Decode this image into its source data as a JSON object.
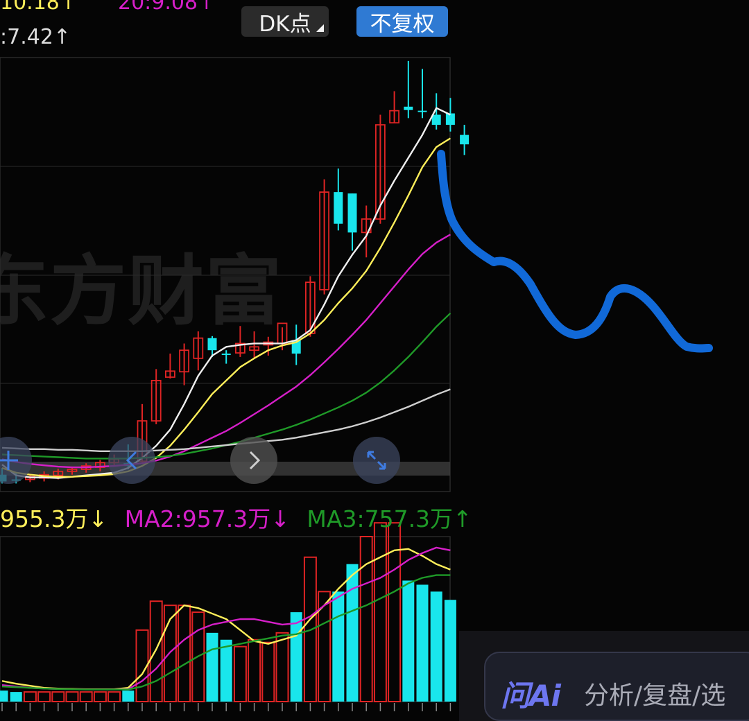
{
  "header": {
    "ma_top_1": "10.18↑",
    "ma_top_2": "20:9.08↑",
    "ma_top_3": ":7.42↑",
    "dk_button": "DK点",
    "adjust_button": "不复权"
  },
  "watermark": "东方财富",
  "volume_legend": {
    "ma1": "955.3万↓",
    "ma2": "MA2:957.3万↓",
    "ma3": "MA3:757.3万↑"
  },
  "ai_bar": {
    "logo": "问Ai",
    "hint": "分析/复盘/选"
  },
  "colors": {
    "up": "#e02424",
    "down": "#19e6ec",
    "ma_white": "#f0f0f0",
    "ma_yellow": "#ffef5a",
    "ma_magenta": "#d61fc9",
    "ma_green": "#1f9a28",
    "ma_gray": "#cfcfcf",
    "annotation": "#1169d8",
    "button_blue": "#2f7ad3"
  },
  "icons": [
    "crosshair-icon",
    "chevron-left-icon",
    "chevron-right-icon",
    "expand-icon"
  ],
  "chart_data": {
    "type": "candlestick",
    "price_axis_labels": [],
    "candles": [
      {
        "o": 6.25,
        "h": 6.35,
        "l": 6.12,
        "c": 6.15,
        "dir": "down"
      },
      {
        "o": 6.16,
        "h": 6.28,
        "l": 6.12,
        "c": 6.18,
        "dir": "down"
      },
      {
        "o": 6.18,
        "h": 6.26,
        "l": 6.14,
        "c": 6.22,
        "dir": "up"
      },
      {
        "o": 6.2,
        "h": 6.3,
        "l": 6.15,
        "c": 6.25,
        "dir": "up"
      },
      {
        "o": 6.24,
        "h": 6.34,
        "l": 6.18,
        "c": 6.3,
        "dir": "up"
      },
      {
        "o": 6.3,
        "h": 6.36,
        "l": 6.25,
        "c": 6.33,
        "dir": "up"
      },
      {
        "o": 6.33,
        "h": 6.42,
        "l": 6.28,
        "c": 6.38,
        "dir": "up"
      },
      {
        "o": 6.36,
        "h": 6.47,
        "l": 6.3,
        "c": 6.43,
        "dir": "up"
      },
      {
        "o": 6.43,
        "h": 6.55,
        "l": 6.38,
        "c": 6.48,
        "dir": "up"
      },
      {
        "o": 6.38,
        "h": 6.7,
        "l": 6.33,
        "c": 6.42,
        "dir": "down"
      },
      {
        "o": 6.45,
        "h": 7.3,
        "l": 6.42,
        "c": 7.05,
        "dir": "up"
      },
      {
        "o": 7.05,
        "h": 7.82,
        "l": 7.0,
        "c": 7.65,
        "dir": "up"
      },
      {
        "o": 7.7,
        "h": 8.05,
        "l": 7.68,
        "c": 7.79,
        "dir": "up"
      },
      {
        "o": 7.78,
        "h": 8.2,
        "l": 7.58,
        "c": 8.1,
        "dir": "up"
      },
      {
        "o": 7.98,
        "h": 8.38,
        "l": 7.8,
        "c": 8.28,
        "dir": "up"
      },
      {
        "o": 8.28,
        "h": 8.31,
        "l": 8.0,
        "c": 8.1,
        "dir": "down"
      },
      {
        "o": 8.05,
        "h": 8.1,
        "l": 7.9,
        "c": 8.04,
        "dir": "down"
      },
      {
        "o": 8.06,
        "h": 8.46,
        "l": 8.0,
        "c": 8.2,
        "dir": "up"
      },
      {
        "o": 8.1,
        "h": 8.38,
        "l": 7.98,
        "c": 8.15,
        "dir": "up"
      },
      {
        "o": 8.18,
        "h": 8.3,
        "l": 8.02,
        "c": 8.22,
        "dir": "up"
      },
      {
        "o": 8.2,
        "h": 8.44,
        "l": 8.1,
        "c": 8.5,
        "dir": "up"
      },
      {
        "o": 8.25,
        "h": 8.48,
        "l": 7.88,
        "c": 8.05,
        "dir": "down"
      },
      {
        "o": 8.35,
        "h": 9.2,
        "l": 8.3,
        "c": 9.11,
        "dir": "up"
      },
      {
        "o": 9.0,
        "h": 10.64,
        "l": 8.93,
        "c": 10.45,
        "dir": "up"
      },
      {
        "o": 10.45,
        "h": 10.8,
        "l": 9.88,
        "c": 9.98,
        "dir": "down"
      },
      {
        "o": 10.43,
        "h": 10.43,
        "l": 9.58,
        "c": 9.85,
        "dir": "down"
      },
      {
        "o": 9.85,
        "h": 10.25,
        "l": 9.48,
        "c": 10.05,
        "dir": "up"
      },
      {
        "o": 10.05,
        "h": 11.6,
        "l": 9.98,
        "c": 11.45,
        "dir": "up"
      },
      {
        "o": 11.48,
        "h": 11.95,
        "l": 11.48,
        "c": 11.66,
        "dir": "up"
      },
      {
        "o": 11.72,
        "h": 12.4,
        "l": 11.55,
        "c": 11.67,
        "dir": "down"
      },
      {
        "o": 11.65,
        "h": 12.28,
        "l": 11.55,
        "c": 11.66,
        "dir": "down"
      },
      {
        "o": 11.6,
        "h": 11.92,
        "l": 11.38,
        "c": 11.45,
        "dir": "down"
      },
      {
        "o": 11.62,
        "h": 11.85,
        "l": 11.35,
        "c": 11.45,
        "dir": "down"
      },
      {
        "o": 11.3,
        "h": 11.45,
        "l": 11.0,
        "c": 11.16,
        "dir": "down"
      }
    ],
    "ma_lines": [
      {
        "color": "#f0f0f0",
        "values": [
          6.4,
          6.24,
          6.21,
          6.21,
          6.2,
          6.22,
          6.24,
          6.26,
          6.28,
          6.35,
          6.5,
          6.68,
          6.92,
          7.3,
          7.72,
          8.02,
          8.15,
          8.18,
          8.2,
          8.2,
          8.2,
          8.25,
          8.4,
          8.78,
          9.2,
          9.52,
          9.8,
          10.25,
          10.62,
          10.96,
          11.3,
          11.7,
          11.6
        ]
      },
      {
        "color": "#ffef5a",
        "values": [
          6.35,
          6.28,
          6.25,
          6.23,
          6.22,
          6.22,
          6.23,
          6.24,
          6.26,
          6.3,
          6.38,
          6.5,
          6.68,
          6.92,
          7.18,
          7.45,
          7.65,
          7.85,
          7.98,
          8.1,
          8.17,
          8.22,
          8.35,
          8.55,
          8.8,
          9.02,
          9.28,
          9.62,
          10.0,
          10.4,
          10.82,
          11.12,
          11.25
        ]
      },
      {
        "color": "#d61fc9",
        "values": [
          6.48,
          6.44,
          6.41,
          6.39,
          6.37,
          6.36,
          6.36,
          6.37,
          6.38,
          6.4,
          6.42,
          6.46,
          6.52,
          6.6,
          6.7,
          6.8,
          6.9,
          7.02,
          7.15,
          7.28,
          7.42,
          7.56,
          7.73,
          7.92,
          8.12,
          8.33,
          8.55,
          8.8,
          9.05,
          9.3,
          9.53,
          9.7,
          9.82
        ]
      },
      {
        "color": "#1f9a28",
        "values": [
          6.55,
          6.54,
          6.53,
          6.52,
          6.51,
          6.5,
          6.49,
          6.49,
          6.49,
          6.49,
          6.5,
          6.51,
          6.53,
          6.56,
          6.6,
          6.64,
          6.69,
          6.74,
          6.8,
          6.86,
          6.92,
          6.99,
          7.07,
          7.16,
          7.25,
          7.35,
          7.47,
          7.62,
          7.8,
          8.0,
          8.22,
          8.45,
          8.65
        ]
      },
      {
        "color": "#cfcfcf",
        "values": [
          6.65,
          6.64,
          6.63,
          6.63,
          6.62,
          6.62,
          6.61,
          6.6,
          6.6,
          6.6,
          6.6,
          6.61,
          6.62,
          6.63,
          6.65,
          6.67,
          6.69,
          6.71,
          6.73,
          6.75,
          6.77,
          6.8,
          6.84,
          6.88,
          6.92,
          6.97,
          7.03,
          7.1,
          7.18,
          7.26,
          7.35,
          7.44,
          7.52
        ]
      }
    ],
    "volume": {
      "values": [
        80,
        70,
        70,
        70,
        70,
        70,
        70,
        70,
        70,
        80,
        520,
        730,
        700,
        700,
        650,
        500,
        450,
        400,
        450,
        430,
        500,
        650,
        1050,
        800,
        800,
        1000,
        1200,
        1300,
        1300,
        880,
        850,
        800,
        740
      ],
      "ma_lines": [
        {
          "color": "#ffef5a",
          "values": [
            150,
            130,
            115,
            100,
            95,
            92,
            90,
            90,
            90,
            100,
            200,
            380,
            600,
            700,
            680,
            640,
            600,
            520,
            440,
            420,
            450,
            480,
            600,
            700,
            820,
            920,
            1000,
            1050,
            1100,
            1110,
            1060,
            1000,
            960
          ]
        },
        {
          "color": "#d61fc9",
          "values": [
            120,
            110,
            100,
            95,
            92,
            90,
            88,
            88,
            88,
            90,
            150,
            240,
            360,
            450,
            520,
            560,
            580,
            600,
            600,
            580,
            560,
            570,
            620,
            700,
            760,
            820,
            860,
            900,
            960,
            1030,
            1080,
            1120,
            1100
          ]
        },
        {
          "color": "#1f9a28",
          "values": [
            110,
            105,
            100,
            95,
            92,
            90,
            88,
            88,
            88,
            88,
            110,
            150,
            210,
            270,
            330,
            380,
            400,
            420,
            440,
            460,
            480,
            490,
            520,
            570,
            620,
            660,
            700,
            750,
            800,
            860,
            900,
            920,
            920
          ]
        }
      ]
    },
    "annotation": "hand-drawn blue forecast curve"
  }
}
